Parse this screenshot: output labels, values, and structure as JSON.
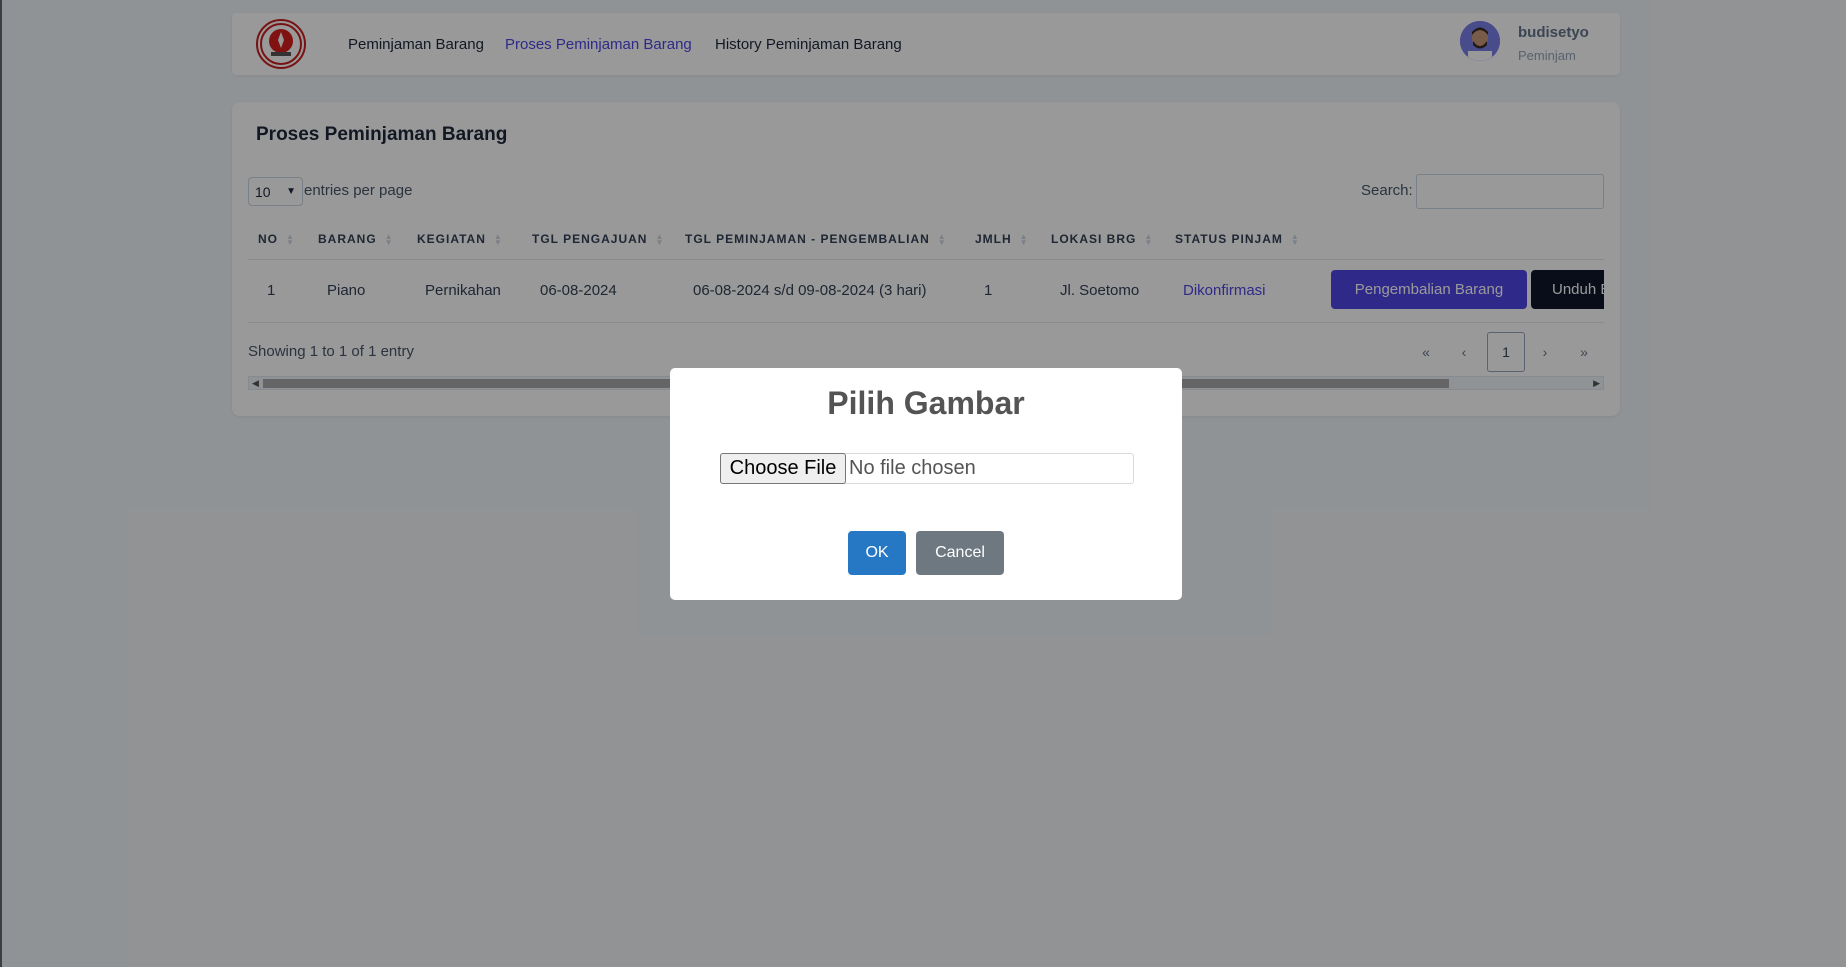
{
  "nav": {
    "links": [
      {
        "label": "Peminjaman Barang"
      },
      {
        "label": "Proses Peminjaman Barang"
      },
      {
        "label": "History Peminjaman Barang"
      }
    ],
    "user": {
      "name": "budisetyo",
      "role": "Peminjam"
    }
  },
  "card": {
    "title": "Proses Peminjaman Barang",
    "per_page_value": "10",
    "per_page_label": "entries per page",
    "search_label": "Search:",
    "search_value": "",
    "columns": [
      "NO",
      "BARANG",
      "KEGIATAN",
      "TGL PENGAJUAN",
      "TGL PEMINJAMAN - PENGEMBALIAN",
      "JMLH",
      "LOKASI BRG",
      "STATUS PINJAM"
    ],
    "rows": [
      {
        "no": "1",
        "barang": "Piano",
        "kegiatan": "Pernikahan",
        "tgl_pengajuan": "06-08-2024",
        "tgl_range": "06-08-2024 s/d 09-08-2024 (3 hari)",
        "jumlah": "1",
        "lokasi": "Jl. Soetomo",
        "status": "Dikonfirmasi",
        "action_return": "Pengembalian Barang",
        "action_download": "Unduh B"
      }
    ],
    "info": "Showing 1 to 1 of 1 entry",
    "pagination": {
      "first": "«",
      "prev": "‹",
      "current": "1",
      "next": "›",
      "last": "»"
    }
  },
  "modal": {
    "title": "Pilih Gambar",
    "choose_file": "Choose File",
    "no_file": "No file chosen",
    "ok": "OK",
    "cancel": "Cancel"
  },
  "colors": {
    "accent": "#4f46e5",
    "ok_button": "#2778c4",
    "cancel_button": "#6e7881"
  }
}
